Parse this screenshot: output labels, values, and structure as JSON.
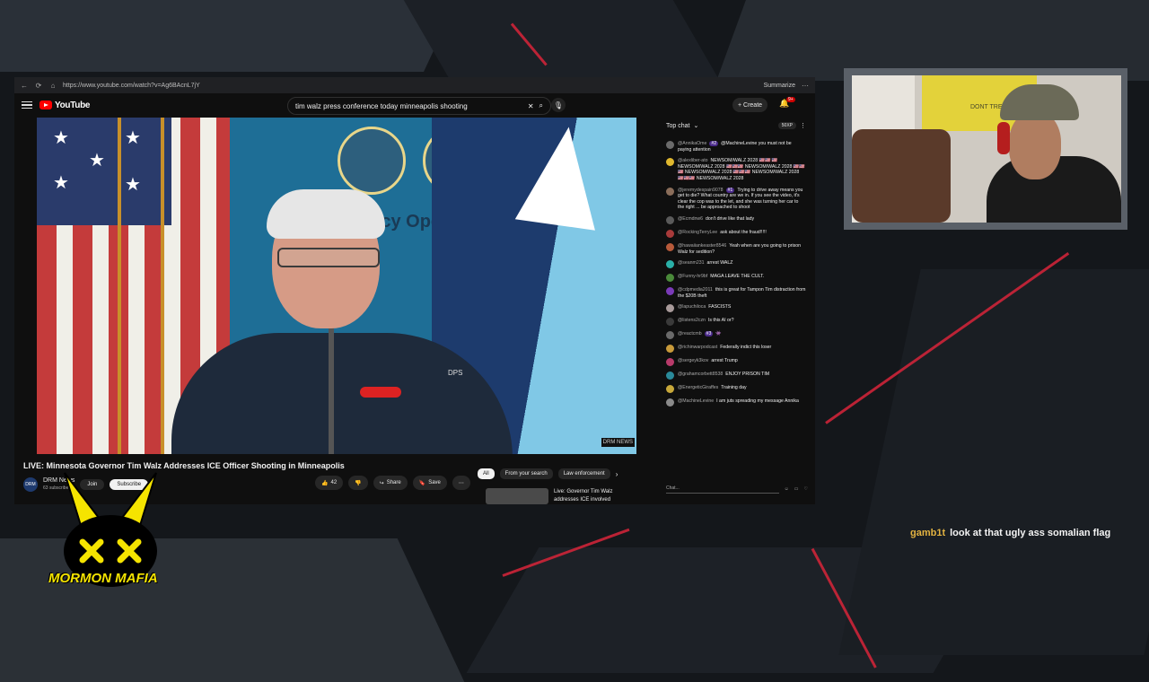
{
  "browser": {
    "url": "https://www.youtube.com/watch?v=Ag6BAcnL7jY",
    "summarize": "Summarize"
  },
  "youtube": {
    "logo": "YouTube",
    "search_query": "tim walz press conference today minneapolis shooting",
    "create": "+ Create",
    "notif_count": "9+"
  },
  "video": {
    "watermark": "DRM NEWS",
    "title": "LIVE: Minnesota Governor Tim Walz Addresses ICE Officer Shooting in Minneapolis",
    "channel_initials": "DRM",
    "channel": "DRM News",
    "subscribers": "63 subscribers",
    "join": "Join",
    "subscribe": "Subscribe",
    "likes": "42",
    "share": "Share",
    "save": "Save",
    "jacket_text": "DPS",
    "wall_text": "ency Ope"
  },
  "chips": [
    "All",
    "From your search",
    "Law enforcement"
  ],
  "recommendation": {
    "title": "Live: Governor Tim Walz addresses ICE involved"
  },
  "chat": {
    "mode": "Top chat",
    "xp": "50XP",
    "placeholder": "Chat...",
    "messages": [
      {
        "user": "@AnnikaOme",
        "badge": "#2",
        "text": "@MachineLevine you must not be paying attention",
        "color": "#6b6b6b"
      },
      {
        "user": "@alexliber-ato",
        "text": "NEWSOM/WALZ 2028 🇺🇸🇺🇸 🇺🇸 NEWSOM/WALZ 2028 🇺🇸🇺🇸🇺🇸 NEWSOM/WALZ 2028 🇺🇸🇺🇸🇺🇸 NEWSOM/WALZ 2028 🇺🇸🇺🇸🇺🇸 NEWSOM/WALZ 2028 🇺🇸🇺🇸🇺🇸 NEWSOM/WALZ 2028",
        "color": "#e0b82e"
      },
      {
        "user": "@jeremydespain9078",
        "badge": "#1",
        "text": "Trying to drive away means you get to die? What country are we in. If you see the video, it's clear the cop was to the let, and she was turning her car to the right ... be approached to shoot",
        "color": "#8a6d5a"
      },
      {
        "user": "@Ecmdnw6",
        "text": "don't drive like that lady",
        "color": "#5a5a5a"
      },
      {
        "user": "@RockingTerryLee",
        "text": "ask about the fraud!!!!!",
        "color": "#a83a3a"
      },
      {
        "user": "@hawaiiankeaster8546",
        "text": "Yeah when are you going to prison Walz for sedition?",
        "color": "#b85a3a"
      },
      {
        "user": "@seanm231",
        "text": "arrest WALZ",
        "color": "#2ab0a8"
      },
      {
        "user": "@Funny-hr9bf",
        "text": "MAGA LEAVE THE CULT.",
        "color": "#4a8a3a"
      },
      {
        "user": "@cdpmedia2011",
        "text": "this is great for Tampon Tim distraction from the $20B theft",
        "color": "#7a3ab8"
      },
      {
        "user": "@lapuchiloca",
        "text": "FASCISTS",
        "color": "#a89a9a"
      },
      {
        "user": "@listens2czn",
        "text": "Is this AI or?",
        "color": "#3a3a3a"
      },
      {
        "user": "@reactcmb",
        "badge": "#3",
        "text": "👾",
        "color": "#6a6a6a"
      },
      {
        "user": "@richinwarpodcast",
        "text": "Federally indict this loser",
        "color": "#c89a3a"
      },
      {
        "user": "@sergeyk3kov",
        "text": "arrest Trump",
        "color": "#b83a6a"
      },
      {
        "user": "@grahamcorbett8538",
        "text": "ENJOY PRISON TIM",
        "color": "#2a8a9a"
      },
      {
        "user": "@EnergeticGiraffes",
        "text": "Training day",
        "color": "#c8a83a"
      },
      {
        "user": "@MachineLevine",
        "text": "I am juts spreading my message Annika",
        "color": "#8a8a8a"
      }
    ]
  },
  "webcam": {
    "flag_text": "DONT TREAD"
  },
  "overlay": {
    "user": "gamb1t",
    "message": "look at that ugly ass somalian flag"
  },
  "logo_text": "MORMON MAFIA",
  "colors": {
    "youtube_red": "#ff0000",
    "stream_accent": "#d8253a",
    "logo_yellow": "#f5e400"
  }
}
